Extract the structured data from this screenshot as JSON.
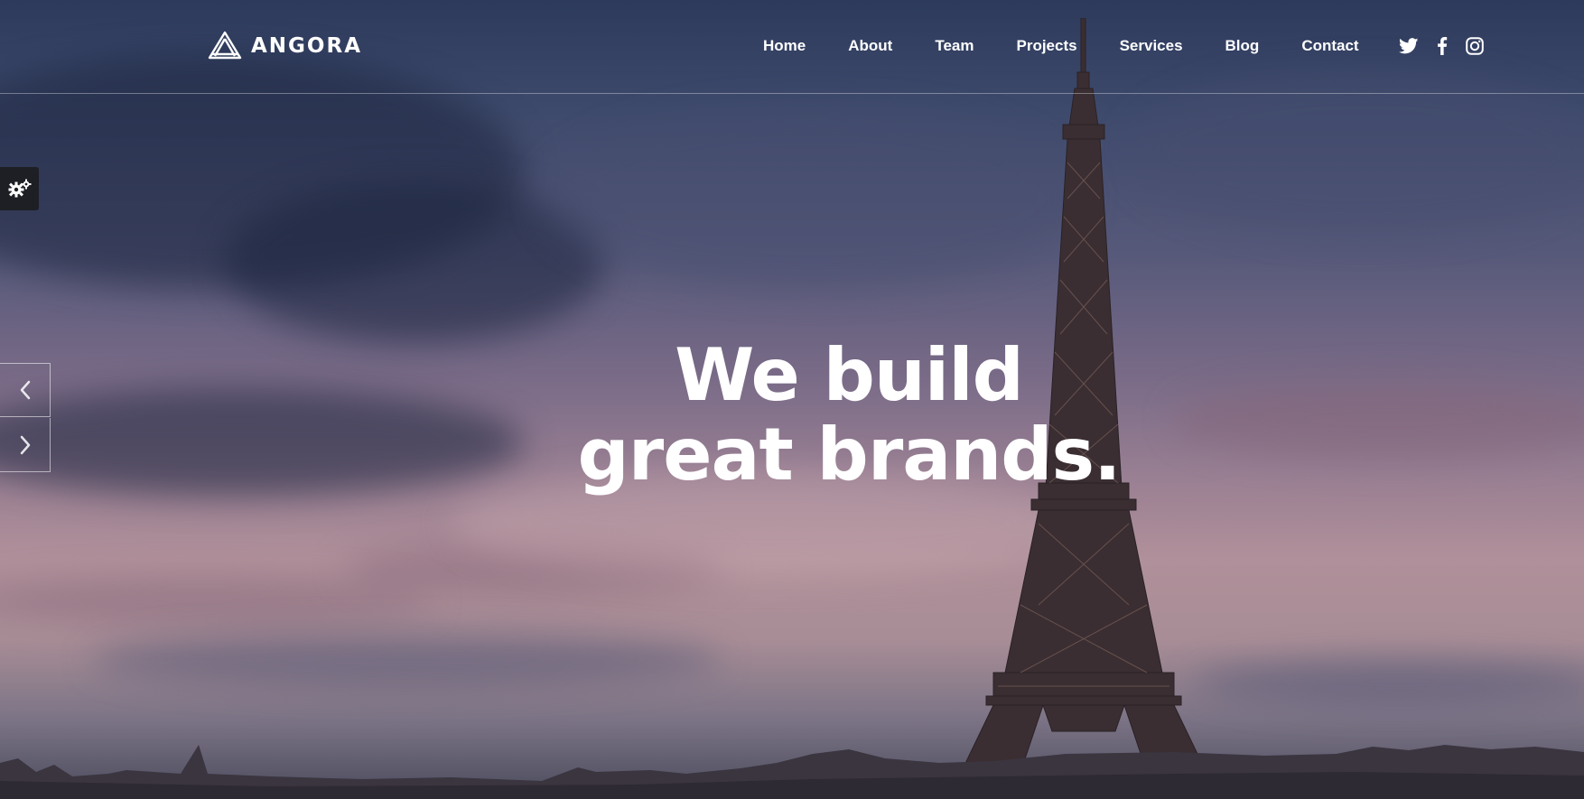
{
  "brand": {
    "name": "ANGORA"
  },
  "nav": {
    "items": [
      "Home",
      "About",
      "Team",
      "Projects",
      "Services",
      "Blog",
      "Contact"
    ]
  },
  "social": {
    "icons": [
      "twitter-icon",
      "facebook-icon",
      "instagram-icon"
    ]
  },
  "hero": {
    "headline_line1": "We build",
    "headline_line2": "great brands."
  },
  "colors": {
    "text": "#ffffff",
    "settings_bg": "#1d1f24",
    "tower": "#3a2e32"
  }
}
